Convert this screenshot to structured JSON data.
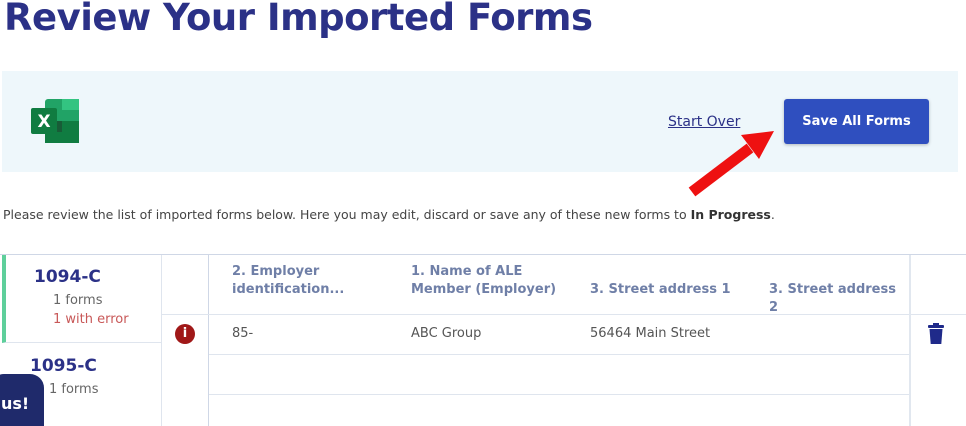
{
  "page": {
    "title": "Review Your Imported Forms"
  },
  "import_bar": {
    "icon": "excel-file-icon",
    "start_over_label": "Start Over",
    "save_all_label": "Save All Forms"
  },
  "instructions": {
    "text": "Please review the list of imported forms below. Here you may edit, discard or save any of these new forms to ",
    "status": "In Progress",
    "suffix": "."
  },
  "form_list": [
    {
      "title": "1094-C",
      "count": "1 forms",
      "error": "1 with error"
    },
    {
      "title": "1095-C",
      "count": "1 forms"
    }
  ],
  "table": {
    "columns": [
      "2. Employer identification...",
      "1. Name of ALE Member (Employer)",
      "3. Street address 1",
      "3. Street address 2"
    ],
    "columns_lines": [
      [
        "2. Employer",
        "identification..."
      ],
      [
        "1. Name of ALE",
        "Member (Employer)"
      ],
      [
        "3. Street address 1"
      ],
      [
        "3. Street address 2"
      ]
    ],
    "rows": [
      {
        "status_icon": "error-icon",
        "status_glyph": "i",
        "cells": [
          "85-",
          "ABC Group",
          "56464 Main Street",
          ""
        ]
      }
    ]
  },
  "chat_badge": {
    "label": "us!"
  },
  "colors": {
    "title": "#2b3187",
    "primary_button": "#2f4fbf",
    "import_bar_bg": "#eef7fb",
    "active_indicator": "#5ecf9b",
    "error": "#a01818",
    "arrow": "#ee1111"
  }
}
